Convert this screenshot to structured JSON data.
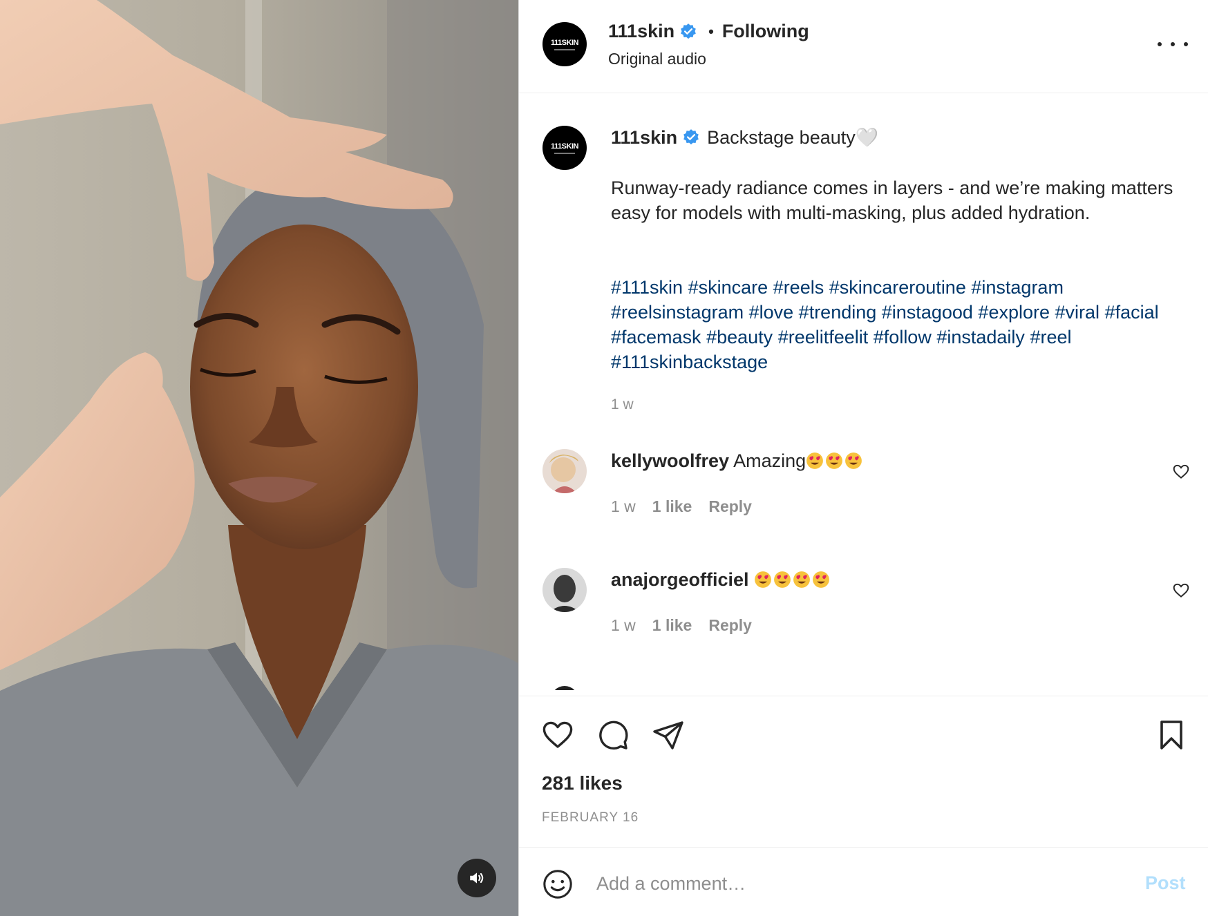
{
  "header": {
    "username": "111skin",
    "separator": "•",
    "follow_status": "Following",
    "audio": "Original audio",
    "avatar_text": "111SKIN"
  },
  "caption": {
    "username": "111skin",
    "title": "Backstage beauty🤍",
    "body": "Runway-ready radiance comes in layers - and we’re making matters easy for models with multi-masking, plus added hydration.",
    "hashtags": [
      "#111skin",
      "#skincare",
      "#reels",
      "#skincareroutine",
      "#instagram",
      "#reelsinstagram",
      "#love",
      "#trending",
      "#instagood",
      "#explore",
      "#viral",
      "#facial",
      "#facemask",
      "#beauty",
      "#reelitfeelit",
      "#follow",
      "#instadaily",
      "#reel",
      "#111skinbackstage"
    ],
    "time": "1 w"
  },
  "comments": [
    {
      "username": "kellywoolfrey",
      "text": "Amazing",
      "emoji_count": 3,
      "time": "1 w",
      "likes": "1 like",
      "reply": "Reply"
    },
    {
      "username": "anajorgeofficiel",
      "text": "",
      "emoji_count": 4,
      "time": "1 w",
      "likes": "1 like",
      "reply": "Reply"
    }
  ],
  "footer": {
    "likes": "281 likes",
    "date": "FEBRUARY 16",
    "comment_placeholder": "Add a comment…",
    "post_label": "Post"
  },
  "icons": {
    "verified": "verified-badge-icon",
    "more": "more-options-icon",
    "like": "heart-icon",
    "comment": "comment-icon",
    "share": "share-icon",
    "save": "bookmark-icon",
    "emoji": "emoji-icon",
    "mute": "speaker-icon"
  },
  "colors": {
    "hashtag": "#00376b",
    "verified": "#3897f0",
    "post_disabled": "#b2dffc",
    "secondary_text": "#8e8e8e"
  }
}
